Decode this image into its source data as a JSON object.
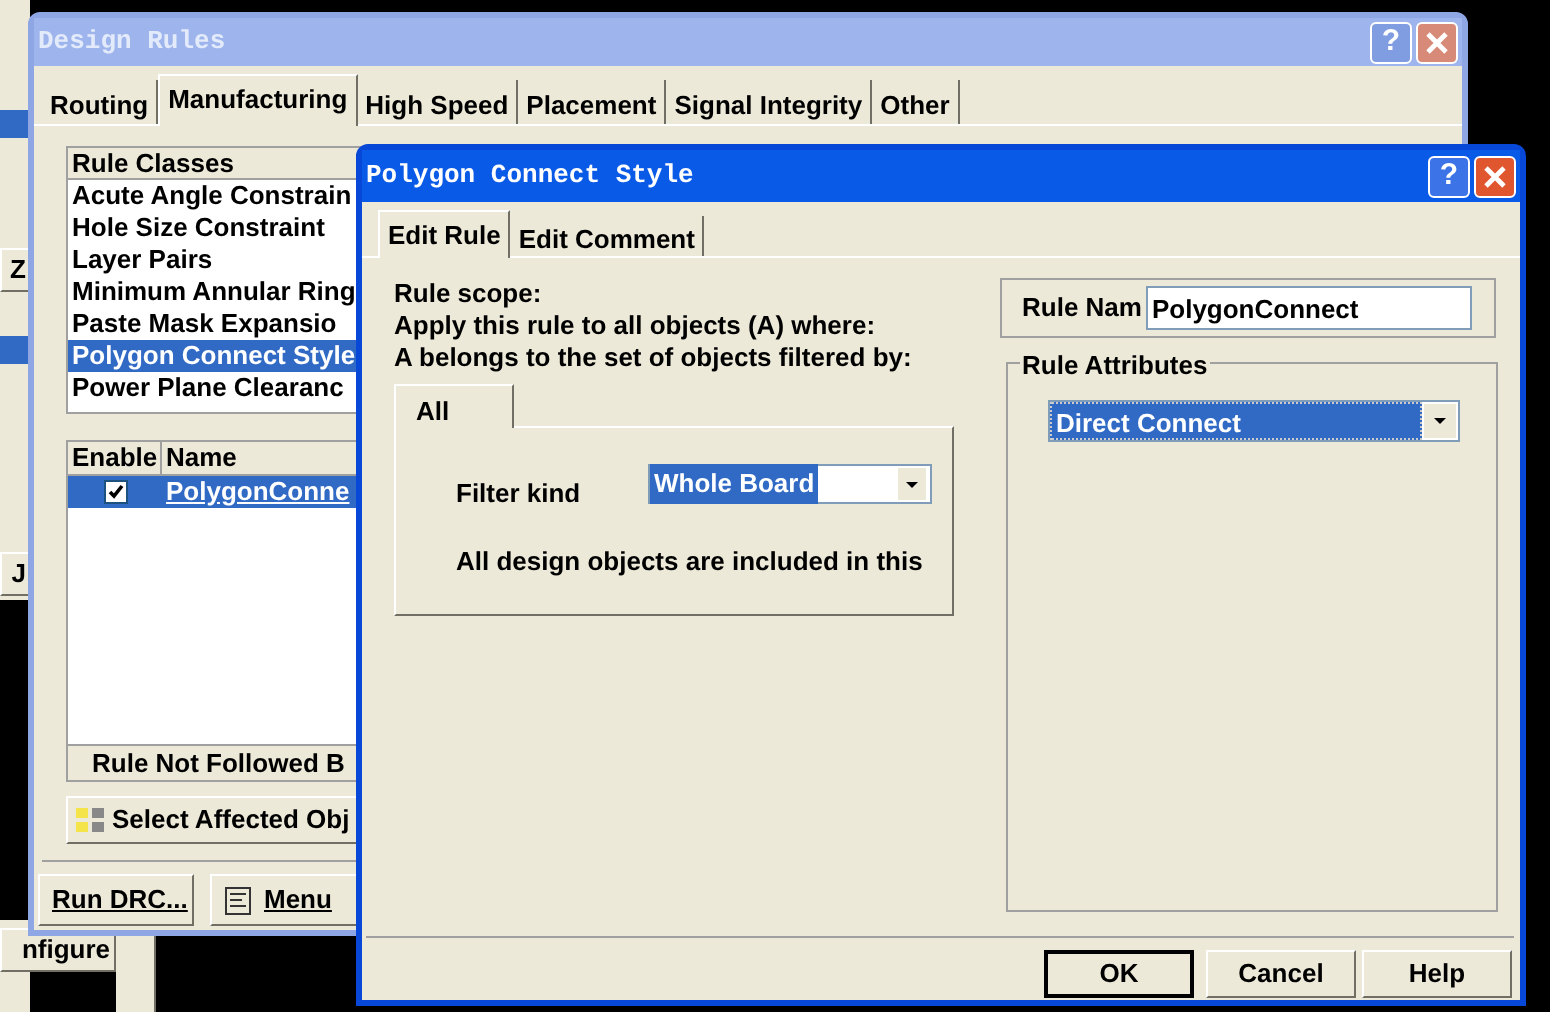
{
  "background": {
    "side_buttons": [
      {
        "label": "Z"
      },
      {
        "label": "J"
      },
      {
        "label": "nfigure"
      }
    ]
  },
  "design_rules": {
    "title": "Design Rules",
    "help_button": "?",
    "tabs": [
      {
        "label": "Routing",
        "selected": false
      },
      {
        "label": "Manufacturing",
        "selected": true
      },
      {
        "label": "High Speed",
        "selected": false
      },
      {
        "label": "Placement",
        "selected": false
      },
      {
        "label": "Signal Integrity",
        "selected": false
      },
      {
        "label": "Other",
        "selected": false
      }
    ],
    "rule_classes": {
      "header": "Rule Classes",
      "items": [
        {
          "label": "Acute Angle Constrain",
          "selected": false
        },
        {
          "label": "Hole Size Constraint",
          "selected": false
        },
        {
          "label": "Layer Pairs",
          "selected": false
        },
        {
          "label": "Minimum Annular Ring",
          "selected": false
        },
        {
          "label": "Paste Mask Expansio",
          "selected": false
        },
        {
          "label": "Polygon Connect Style",
          "selected": true
        },
        {
          "label": "Power Plane Clearanc",
          "selected": false
        }
      ]
    },
    "rules_table": {
      "columns": [
        "Enable",
        "Name"
      ],
      "rows": [
        {
          "enabled": true,
          "name": "PolygonConne",
          "selected": true
        }
      ],
      "footer": "Rule Not Followed B"
    },
    "select_button": "Select Affected Obj",
    "buttons": [
      "Run DRC...",
      "Menu"
    ]
  },
  "polygon_dialog": {
    "title": "Polygon Connect Style",
    "help_button": "?",
    "tabs": [
      {
        "label": "Edit Rule",
        "selected": true
      },
      {
        "label": "Edit Comment",
        "selected": false
      }
    ],
    "scope_lines": [
      "Rule scope:",
      "Apply this rule to all objects (A) where:",
      "A belongs to the set of objects filtered by:"
    ],
    "filter_tab": "All",
    "filter_kind_label": "Filter kind",
    "filter_kind_value": "Whole Board",
    "filter_note": "All design objects are included in this",
    "rule_name_label": "Rule Nam",
    "rule_name_value": "PolygonConnect",
    "attributes_label": "Rule Attributes",
    "connect_style": "Direct Connect",
    "buttons": [
      "OK",
      "Cancel",
      "Help"
    ]
  }
}
